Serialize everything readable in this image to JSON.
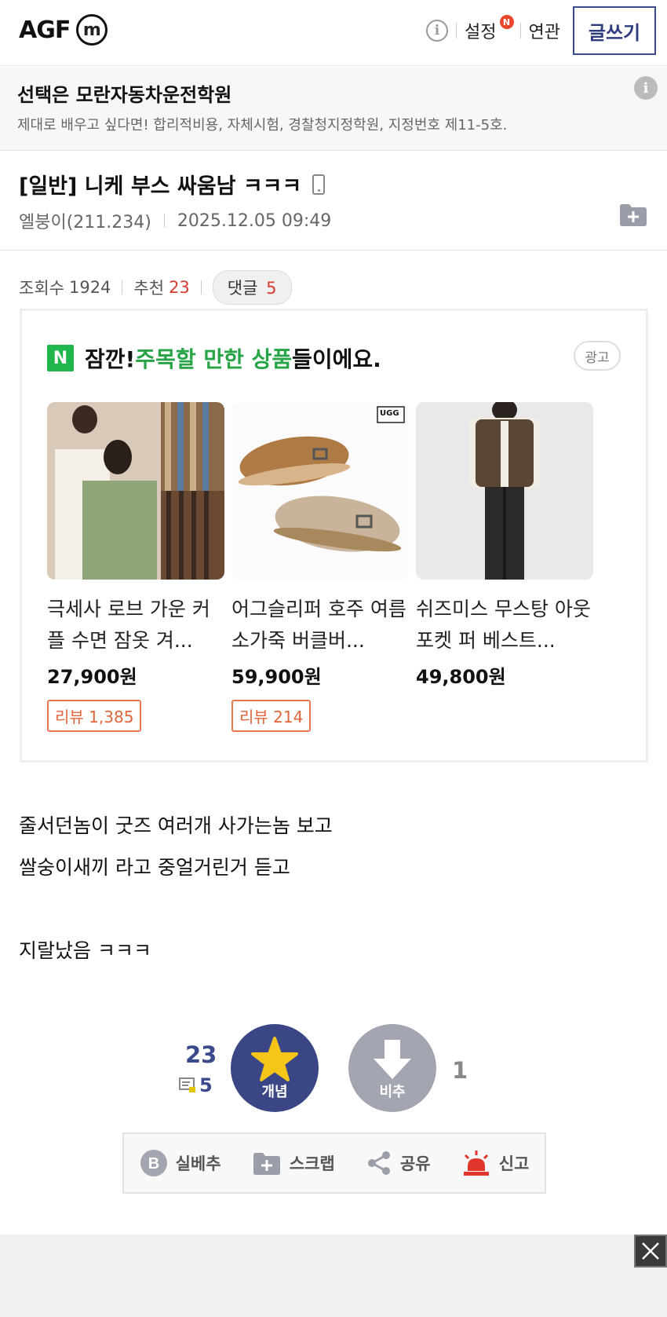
{
  "header": {
    "logo_text": "AGF",
    "logo_mark": "m",
    "info_icon": "i",
    "settings_label": "설정",
    "settings_badge": "N",
    "related_label": "연관",
    "write_label": "글쓰기"
  },
  "ad_banner": {
    "title": "선택은 모란자동차운전학원",
    "description": "제대로 배우고 싶다면! 합리적비용, 자체시험, 경찰청지정학원, 지정번호 제11-5호.",
    "info_icon": "i"
  },
  "post": {
    "title": "[일반] 니케 부스 싸움남 ㅋㅋㅋ",
    "author": "엘붕이(211.234)",
    "datetime": "2025.12.05 09:49",
    "views_label": "조회수",
    "views": "1924",
    "recommend_label": "추천",
    "recommend": "23",
    "comments_label": "댓글",
    "comments": "5",
    "body_lines": [
      "줄서던놈이 굿즈 여러개 사가는놈 보고",
      "쌀숭이새끼 라고 중얼거린거 듣고",
      "",
      "지랄났음 ㅋㅋㅋ"
    ]
  },
  "product_ad": {
    "n_logo": "N",
    "head_prefix": "잠깐! ",
    "head_highlight": "주목할 만한 상품",
    "head_suffix": "들이에요.",
    "ad_label": "광고",
    "products": [
      {
        "name": "극세사 로브 가운 커플 수면 잠옷 겨...",
        "price": "27,900원",
        "review": "리뷰 1,385"
      },
      {
        "name": "어그슬리퍼 호주 여름 소가죽 버클버...",
        "price": "59,900원",
        "review": "리뷰 214"
      },
      {
        "name": "쉬즈미스 무스탕 아웃 포켓 퍼 베스트...",
        "price": "49,800원",
        "review": ""
      }
    ],
    "ugg_tag": "UGG"
  },
  "vote": {
    "up_count": "23",
    "comment_count": "5",
    "up_label": "개념",
    "down_label": "비추",
    "down_count": "1"
  },
  "actions": {
    "real_best": "실베추",
    "scrap": "스크랩",
    "share": "공유",
    "report": "신고"
  },
  "colors": {
    "brand_navy": "#3a4685",
    "ad_green": "#27a446",
    "review_orange": "#e0653b",
    "recommend_red": "#d63b2f"
  }
}
